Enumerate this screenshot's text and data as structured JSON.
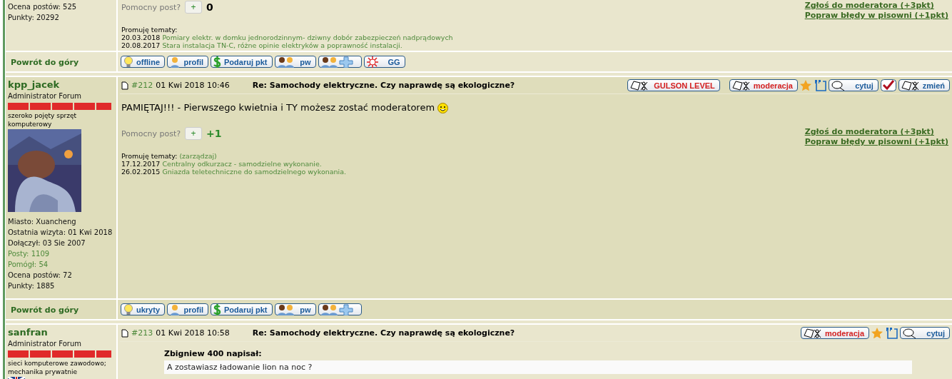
{
  "posts": [
    {
      "author": {
        "stats": [
          {
            "text": "Ocena postów: 525",
            "kind": "plain"
          },
          {
            "text": "Punkty: 20292",
            "kind": "plain"
          }
        ]
      },
      "helpful": {
        "label": "Pomocny post?",
        "plus": "+",
        "score": "0"
      },
      "report_links": [
        "Zgłoś do moderatora (+3pkt)",
        "Popraw błędy w pisowni (+1pkt)"
      ],
      "promoted": {
        "label": "Promuję tematy:",
        "items": [
          {
            "date": "20.03.2018",
            "title": "Pomiary elektr. w domku jednorodzinnym- dziwny dobór zabezpieczeń nadprądowych"
          },
          {
            "date": "20.08.2017",
            "title": "Stara instalacja TN-C, różne opinie elektryków a poprawność instalacji."
          }
        ]
      },
      "footer": {
        "back": "Powrót do góry",
        "buttons": [
          {
            "kind": "status",
            "label": "offline"
          },
          {
            "kind": "profile",
            "label": "profil"
          },
          {
            "kind": "gift",
            "label": "Podaruj pkt"
          },
          {
            "kind": "message",
            "label": "pw"
          },
          {
            "kind": "buddy"
          },
          {
            "kind": "gg",
            "label": "GG"
          }
        ]
      }
    },
    {
      "author": {
        "name": "kpp_jacek",
        "rank": "Administrator Forum",
        "interests": "szeroko pojęty sprzęt komputerowy",
        "stats": [
          {
            "text": "Miasto: Xuancheng",
            "kind": "plain"
          },
          {
            "text": "Ostatnia wizyta: 01 Kwi 2018",
            "kind": "plain"
          },
          {
            "text": "Dołączył: 03 Sie 2007",
            "kind": "plain"
          },
          {
            "text": "Posty: 1109",
            "kind": "link"
          },
          {
            "text": "Pomógł: 54",
            "kind": "link"
          },
          {
            "text": "Ocena postów: 72",
            "kind": "plain"
          },
          {
            "text": "Punkty: 1885",
            "kind": "plain"
          }
        ]
      },
      "header": {
        "number": "#212",
        "date": "01 Kwi 2018 10:46",
        "subject": "Re: Samochody elektryczne. Czy naprawdę są ekologiczne?"
      },
      "actions": [
        {
          "kind": "level",
          "label": "GULSON LEVEL"
        },
        {
          "kind": "moderation",
          "label": "moderacja"
        },
        {
          "kind": "star"
        },
        {
          "kind": "quote"
        },
        {
          "kind": "cite",
          "label": "cytuj"
        },
        {
          "kind": "check"
        },
        {
          "kind": "edit",
          "label": "zmień"
        }
      ],
      "body": [
        {
          "kind": "text",
          "text": "PAMIĘTAJ!!! - Pierwszego kwietnia i TY możesz zostać moderatorem",
          "smiley": true
        }
      ],
      "helpful": {
        "label": "Pomocny post?",
        "plus": "+",
        "score": "+1"
      },
      "report_links": [
        "Zgłoś do moderatora (+3pkt)",
        "Popraw błędy w pisowni (+1pkt)"
      ],
      "promoted": {
        "label": "Promuję tematy:",
        "manage": "(zarządzaj)",
        "items": [
          {
            "date": "17.12.2017",
            "title": "Centralny odkurzacz - samodzielne wykonanie."
          },
          {
            "date": "26.02.2015",
            "title": "Gniazda teletechniczne do samodzielnego wykonania."
          }
        ]
      },
      "footer": {
        "back": "Powrót do góry",
        "buttons": [
          {
            "kind": "status",
            "label": "ukryty"
          },
          {
            "kind": "profile",
            "label": "profil"
          },
          {
            "kind": "gift",
            "label": "Podaruj pkt"
          },
          {
            "kind": "message",
            "label": "pw"
          },
          {
            "kind": "buddy"
          }
        ]
      }
    },
    {
      "author": {
        "name": "sanfran",
        "rank": "Administrator Forum",
        "interests": "sieci komputerowe zawodowo; mechanika prywatnie",
        "flag": true
      },
      "header": {
        "number": "#213",
        "date": "01 Kwi 2018 10:58",
        "subject": "Re: Samochody elektryczne. Czy naprawdę są ekologiczne?"
      },
      "actions": [
        {
          "kind": "moderation",
          "label": "moderacja"
        },
        {
          "kind": "star"
        },
        {
          "kind": "quote"
        },
        {
          "kind": "cite",
          "label": "cytuj"
        }
      ],
      "body": [
        {
          "kind": "quote",
          "author": "Zbigniew 400 napisał:",
          "text": "A zostawiasz ładowanie lion na noc ?"
        }
      ]
    }
  ]
}
